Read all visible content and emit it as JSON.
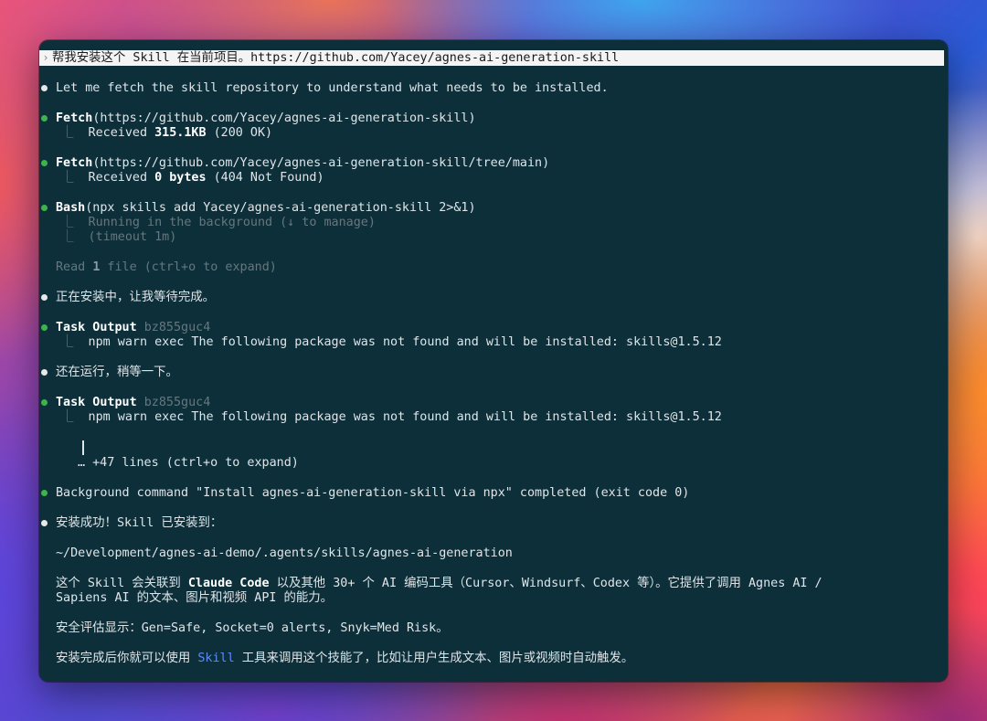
{
  "prompt": {
    "text": "帮我安装这个 Skill 在当前项目。https://github.com/Yacey/agnes-ai-generation-skill"
  },
  "messages": {
    "fetch_intro": "Let me fetch the skill repository to understand what needs to be installed.",
    "fetch1_tool": "Fetch",
    "fetch1_args": "(https://github.com/Yacey/agnes-ai-generation-skill)",
    "fetch1_result_prefix": "Received ",
    "fetch1_result_size": "315.1KB",
    "fetch1_result_status": " (200 OK)",
    "fetch2_tool": "Fetch",
    "fetch2_args": "(https://github.com/Yacey/agnes-ai-generation-skill/tree/main)",
    "fetch2_result_prefix": "Received ",
    "fetch2_result_size": "0 bytes",
    "fetch2_result_status": " (404 Not Found)",
    "bash_tool": "Bash",
    "bash_args": "(npx skills add Yacey/agnes-ai-generation-skill 2>&1)",
    "bash_status1": "Running in the background (↓ to manage)",
    "bash_status2": "(timeout 1m)",
    "read_prefix": "Read ",
    "read_count": "1",
    "read_suffix": " file (ctrl+o to expand)",
    "installing": "正在安装中，让我等待完成。",
    "task1_tool": "Task Output",
    "task1_id": " bz855guc4",
    "task1_output": "npm warn exec The following package was not found and will be installed: skills@1.5.12",
    "still_running": "还在运行，稍等一下。",
    "task2_tool": "Task Output",
    "task2_id": " bz855guc4",
    "task2_output": "npm warn exec The following package was not found and will be installed: skills@1.5.12",
    "more_lines": "… +47 lines (ctrl+o to expand)",
    "bg_complete": "Background command \"Install agnes-ai-generation-skill via npx\" completed (exit code 0)",
    "success": "安装成功！Skill 已安装到：",
    "install_path": "~/Development/agnes-ai-demo/.agents/skills/agnes-ai-generation",
    "desc1_prefix": "这个 Skill 会关联到 ",
    "desc1_bold": "Claude Code",
    "desc1_suffix": " 以及其他 30+ 个 AI 编码工具（Cursor、Windsurf、Codex 等）。它提供了调用 Agnes AI /",
    "desc2": "Sapiens AI 的文本、图片和视频 API 的能力。",
    "security": "安全评估显示：Gen=Safe, Socket=0 alerts, Snyk=Med Risk。",
    "usage_prefix": "安装完成后你就可以使用 ",
    "usage_link": "Skill",
    "usage_suffix": " 工具来调用这个技能了，比如让用户生成文本、图片或视频时自动触发。"
  },
  "symbols": {
    "prompt_chevron": "›",
    "elbow": "⎿"
  },
  "colors": {
    "terminal_bg": "#0d2f3a",
    "bullet_green": "#3bb54a",
    "bullet_white": "#e8e8e8",
    "dim_text": "#66777d",
    "skill_link": "#5b8cf6"
  }
}
